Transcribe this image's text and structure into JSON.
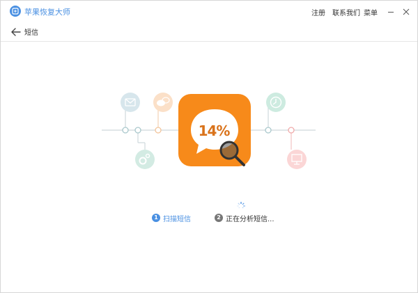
{
  "app": {
    "title": "苹果恢复大师",
    "menu": {
      "register": "注册",
      "contact": "联系我们",
      "menu": "菜单"
    }
  },
  "nav": {
    "page_title": "短信"
  },
  "progress": {
    "percent_text": "14%",
    "value": 14
  },
  "steps": [
    {
      "number": "1",
      "label": "扫描短信",
      "state": "done"
    },
    {
      "number": "2",
      "label": "正在分析短信...",
      "state": "active"
    }
  ],
  "colors": {
    "brand": "#4a90e2",
    "tile": "#f78a1a",
    "step_done": "#4a90e2",
    "step_active": "#777777"
  },
  "icons": {
    "left_nodes": [
      "mail-icon",
      "chat-bubbles-icon",
      "gear-icon"
    ],
    "right_nodes": [
      "clock-icon",
      "monitor-icon"
    ]
  }
}
